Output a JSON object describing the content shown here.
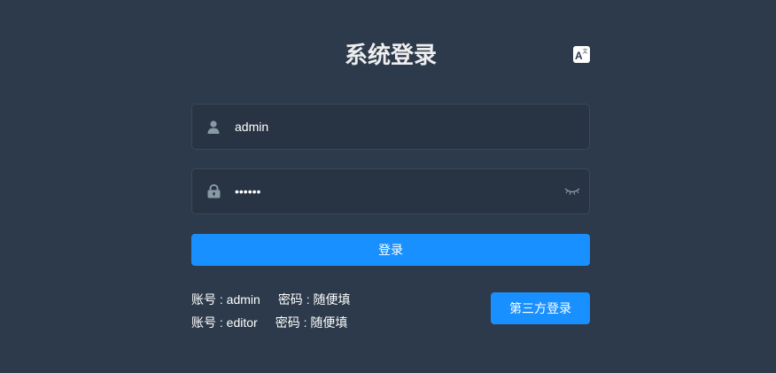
{
  "title": "系统登录",
  "language_icon": "translate-icon",
  "username": {
    "icon": "user-icon",
    "value": "admin"
  },
  "password": {
    "icon": "lock-icon",
    "value": "111111",
    "toggle_icon": "eye-closed-icon"
  },
  "login_button": "登录",
  "tips": [
    {
      "account": "账号 : admin",
      "password": "密码 : 随便填"
    },
    {
      "account": "账号 : editor",
      "password": "密码 : 随便填"
    }
  ],
  "third_party_button": "第三方登录",
  "colors": {
    "background": "#2d3a4b",
    "input_background": "#283443",
    "primary": "#1890ff"
  }
}
